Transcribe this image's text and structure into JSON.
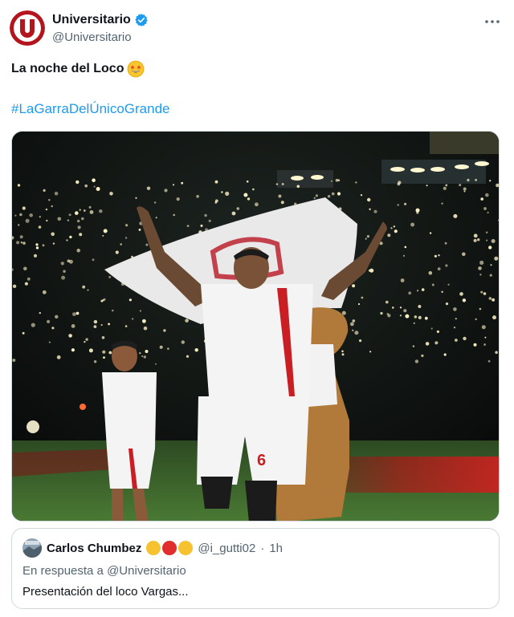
{
  "author": {
    "display_name": "Universitario",
    "handle": "@Universitario",
    "avatar": "universitario-crest-icon",
    "verified": true
  },
  "tweet": {
    "text": "La noche del Loco",
    "emoji": "star-struck-emoji",
    "hashtag": "#LaGarraDelÚnicoGrande"
  },
  "media": {
    "player_number": "6"
  },
  "quoted_tweet": {
    "display_name": "Carlos Chumbez",
    "name_emojis": [
      "yellow-circle",
      "red-circle",
      "yellow-circle"
    ],
    "handle": "@i_gutti02",
    "separator": "·",
    "time": "1h",
    "reply_prefix": "En respuesta a",
    "reply_to": "@Universitario",
    "text": "Presentación del loco Vargas..."
  },
  "colors": {
    "accent": "#1d9bf0",
    "brand_red": "#b3141d",
    "muted": "#536471",
    "text": "#0f1419"
  }
}
